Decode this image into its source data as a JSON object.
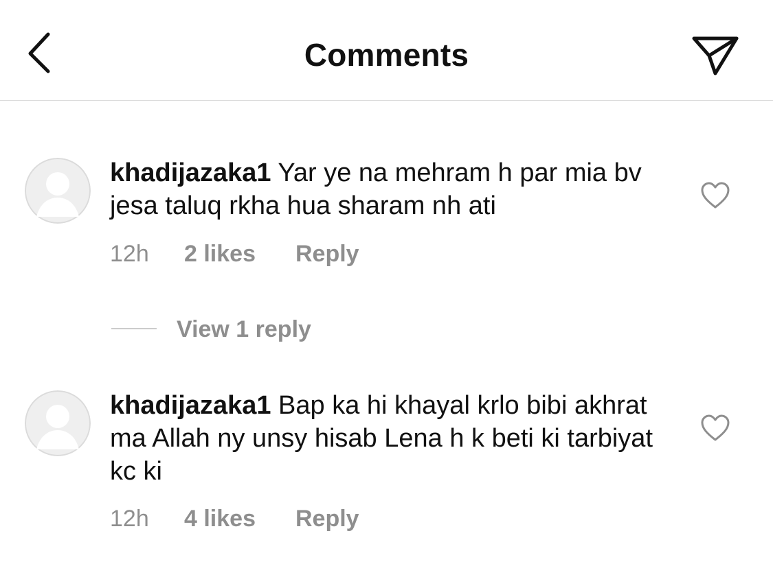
{
  "header": {
    "title": "Comments",
    "back_icon": "chevron-left-icon",
    "share_icon": "paper-plane-icon"
  },
  "comments": [
    {
      "username": "khadijazaka1",
      "text": "Yar ye na mehram h par mia bv jesa taluq rkha hua sharam nh ati",
      "time": "12h",
      "likes": "2 likes",
      "reply": "Reply",
      "view_replies": "View 1 reply"
    },
    {
      "username": "khadijazaka1",
      "text": "Bap ka hi khayal krlo bibi akhrat ma Allah ny unsy hisab Lena h k beti ki tarbiyat kc ki",
      "time": "12h",
      "likes": "4 likes",
      "reply": "Reply"
    }
  ],
  "colors": {
    "text": "#111111",
    "secondary_text": "#8e8e8e",
    "divider": "#dcdcdc",
    "avatar_bg": "#efefef",
    "avatar_fg": "#ffffff"
  }
}
